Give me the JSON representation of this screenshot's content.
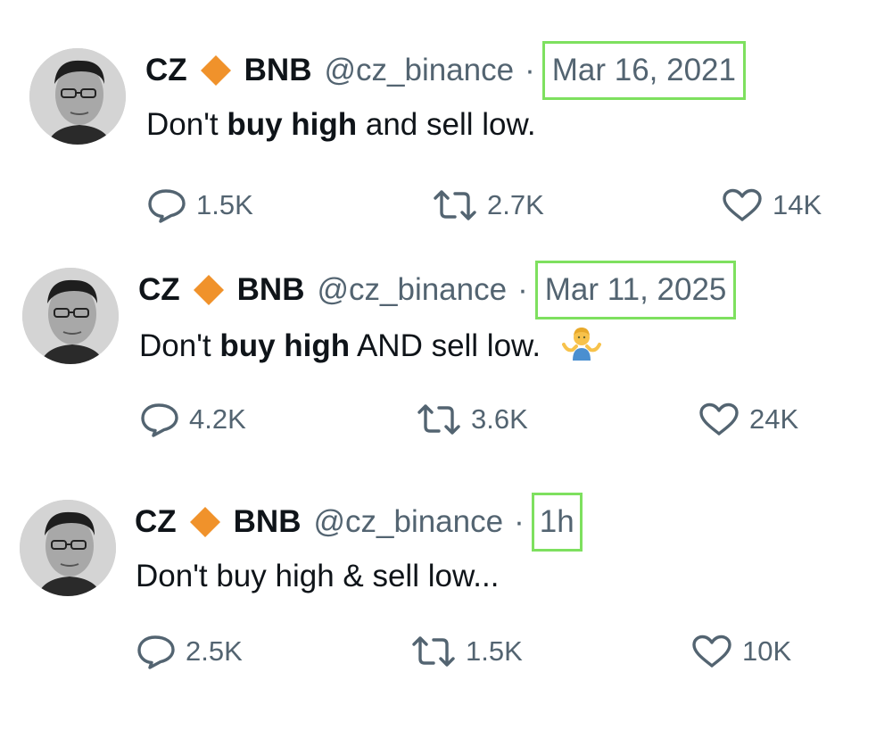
{
  "tweets": [
    {
      "author_name": "CZ",
      "author_suffix": "BNB",
      "handle": "@cz_binance",
      "separator": "·",
      "date": "Mar 16, 2021",
      "text_parts": [
        "Don't ",
        "buy high",
        " and sell low."
      ],
      "replies": "1.5K",
      "retweets": "2.7K",
      "likes": "14K"
    },
    {
      "author_name": "CZ",
      "author_suffix": "BNB",
      "handle": "@cz_binance",
      "separator": "·",
      "date": "Mar 11, 2025",
      "text_parts": [
        "Don't ",
        "buy high",
        " AND sell low."
      ],
      "emoji": "man-shrugging",
      "replies": "4.2K",
      "retweets": "3.6K",
      "likes": "24K"
    },
    {
      "author_name": "CZ",
      "author_suffix": "BNB",
      "handle": "@cz_binance",
      "separator": "·",
      "date": "1h",
      "text_parts": [
        "Don't buy high & sell low..."
      ],
      "replies": "2.5K",
      "retweets": "1.5K",
      "likes": "10K"
    }
  ],
  "colors": {
    "accent_diamond": "#f0922b",
    "highlight_box": "#7ee05f",
    "secondary_text": "#536471",
    "primary_text": "#0f1419"
  }
}
